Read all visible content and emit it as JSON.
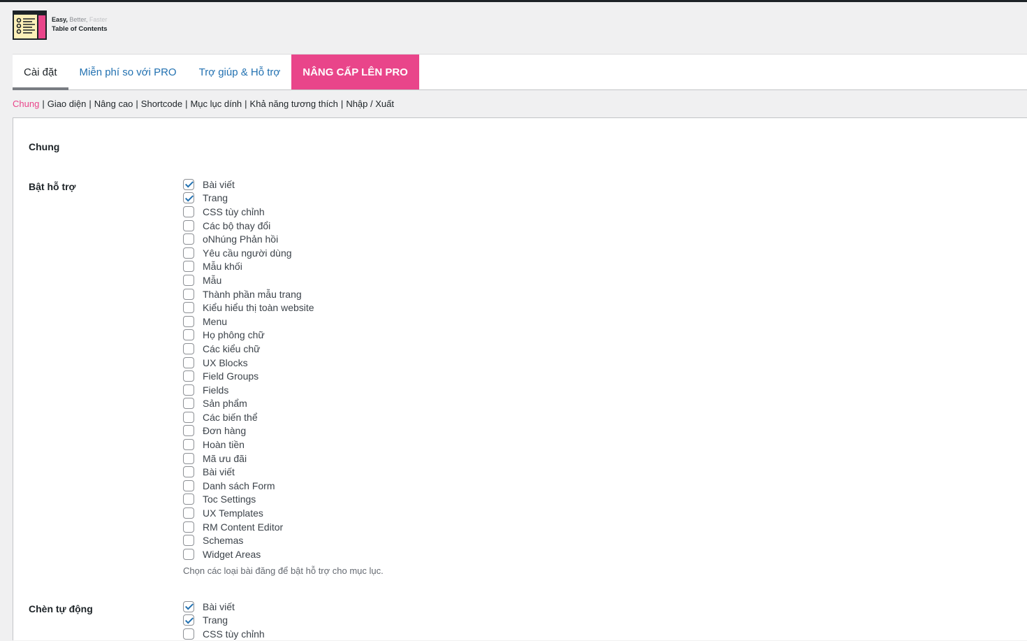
{
  "logo": {
    "word1": "Easy,",
    "word2": "Better,",
    "word3": "Faster",
    "line2": "Table of Contents"
  },
  "tabs": [
    {
      "label": "Cài đặt"
    },
    {
      "label": "Miễn phí so với PRO"
    },
    {
      "label": "Trợ giúp & Hỗ trợ"
    },
    {
      "label": "NÂNG CẤP LÊN PRO"
    }
  ],
  "subnav": [
    {
      "label": "Chung"
    },
    {
      "label": "Giao diện"
    },
    {
      "label": "Nâng cao"
    },
    {
      "label": "Shortcode"
    },
    {
      "label": "Mục lục dính"
    },
    {
      "label": "Khả năng tương thích"
    },
    {
      "label": "Nhập / Xuất"
    }
  ],
  "section": {
    "title": "Chung"
  },
  "enable_support": {
    "label": "Bật hỗ trợ",
    "items": [
      {
        "label": "Bài viết",
        "checked": true
      },
      {
        "label": "Trang",
        "checked": true
      },
      {
        "label": "CSS tùy chỉnh",
        "checked": false
      },
      {
        "label": "Các bộ thay đổi",
        "checked": false
      },
      {
        "label": "oNhúng Phản hồi",
        "checked": false
      },
      {
        "label": "Yêu cầu người dùng",
        "checked": false
      },
      {
        "label": "Mẫu khối",
        "checked": false
      },
      {
        "label": "Mẫu",
        "checked": false
      },
      {
        "label": "Thành phần mẫu trang",
        "checked": false
      },
      {
        "label": "Kiểu hiểu thị toàn website",
        "checked": false
      },
      {
        "label": "Menu",
        "checked": false
      },
      {
        "label": "Họ phông chữ",
        "checked": false
      },
      {
        "label": "Các kiểu chữ",
        "checked": false
      },
      {
        "label": "UX Blocks",
        "checked": false
      },
      {
        "label": "Field Groups",
        "checked": false
      },
      {
        "label": "Fields",
        "checked": false
      },
      {
        "label": "Sản phẩm",
        "checked": false
      },
      {
        "label": "Các biến thể",
        "checked": false
      },
      {
        "label": "Đơn hàng",
        "checked": false
      },
      {
        "label": "Hoàn tiền",
        "checked": false
      },
      {
        "label": "Mã ưu đãi",
        "checked": false
      },
      {
        "label": "Bài viết",
        "checked": false
      },
      {
        "label": "Danh sách Form",
        "checked": false
      },
      {
        "label": "Toc Settings",
        "checked": false
      },
      {
        "label": "UX Templates",
        "checked": false
      },
      {
        "label": "RM Content Editor",
        "checked": false
      },
      {
        "label": "Schemas",
        "checked": false
      },
      {
        "label": "Widget Areas",
        "checked": false
      }
    ],
    "description": "Chọn các loại bài đăng để bật hỗ trợ cho mục lục."
  },
  "auto_insert": {
    "label": "Chèn tự động",
    "items": [
      {
        "label": "Bài viết",
        "checked": true
      },
      {
        "label": "Trang",
        "checked": true
      },
      {
        "label": "CSS tùy chỉnh",
        "checked": false
      }
    ]
  },
  "colors": {
    "accent_pink": "#e9458a",
    "link_blue": "#2271b1",
    "checkbox_check": "#2271b1"
  }
}
